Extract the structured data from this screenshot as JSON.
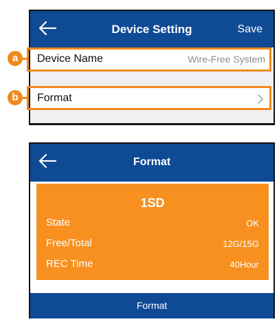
{
  "device_setting_screen": {
    "nav": {
      "title": "Device Setting",
      "save_label": "Save",
      "back_icon": "arrow-left-icon"
    },
    "rows": [
      {
        "label": "Device Name",
        "value": "Wire-Free System",
        "callout": "a"
      },
      {
        "label": "Format",
        "value": "",
        "icon": "chevron-right-icon",
        "callout": "b"
      }
    ]
  },
  "format_screen": {
    "nav": {
      "title": "Format",
      "back_icon": "arrow-left-icon"
    },
    "sd_card": {
      "title": "1SD",
      "state_label": "State",
      "state_value": "OK",
      "free_total_label": "Free/Total",
      "free_total_value": "12G/15G",
      "rec_time_label": "REC Time",
      "rec_time_value": "40Hour"
    },
    "format_button_label": "Format"
  },
  "colors": {
    "nav_blue": "#0f4a95",
    "accent_orange": "#f08a1c",
    "card_orange": "#f7901e"
  }
}
